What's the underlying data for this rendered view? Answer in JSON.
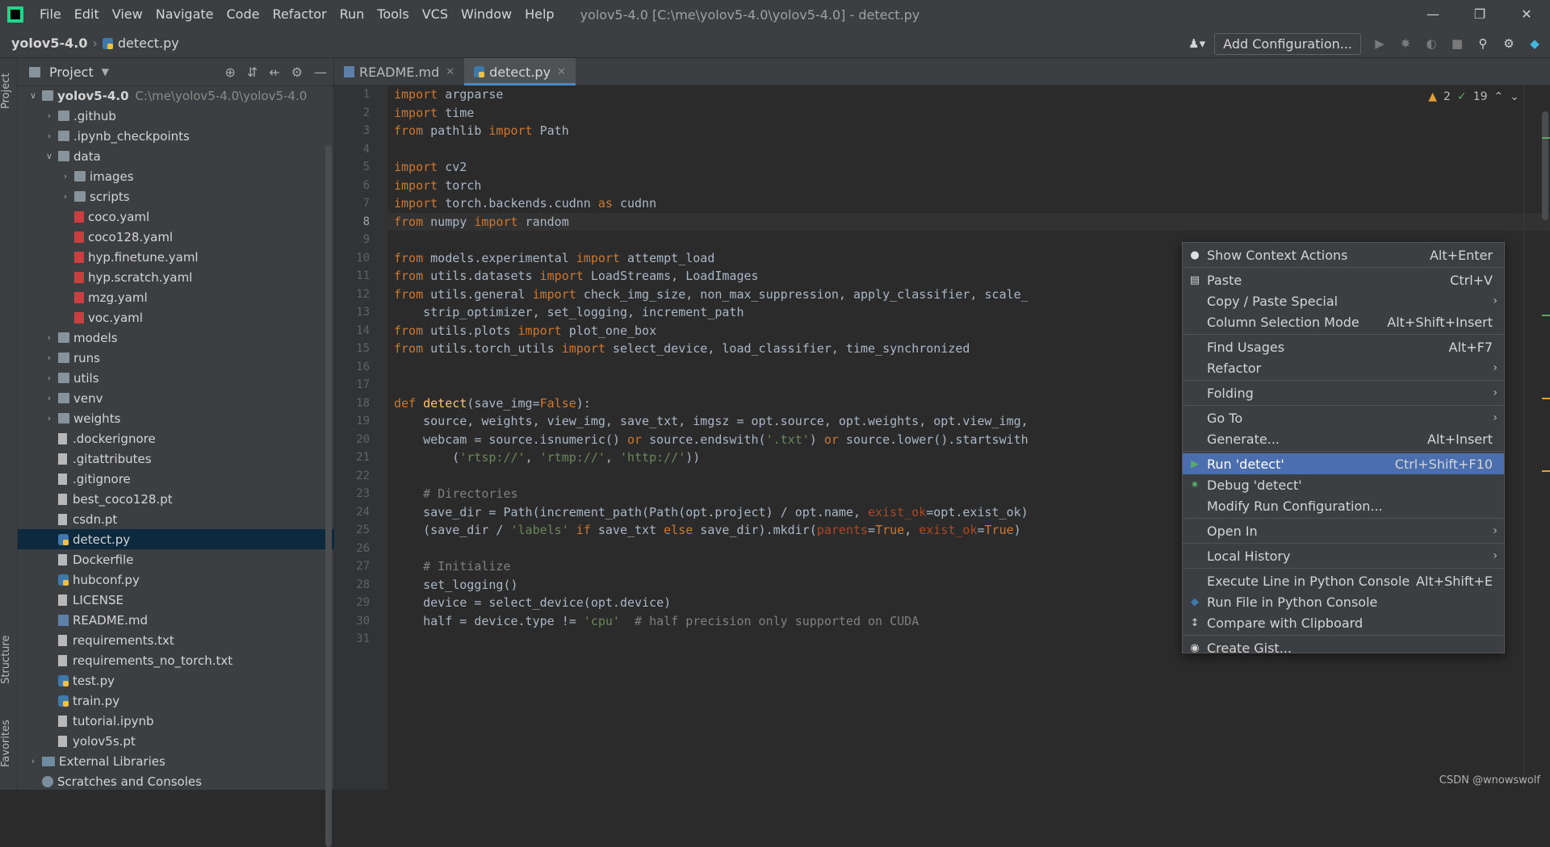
{
  "menubar": {
    "items": [
      "File",
      "Edit",
      "View",
      "Navigate",
      "Code",
      "Refactor",
      "Run",
      "Tools",
      "VCS",
      "Window",
      "Help"
    ],
    "window_title": "yolov5-4.0 [C:\\me\\yolov5-4.0\\yolov5-4.0] - detect.py"
  },
  "navbar": {
    "root": "yolov5-4.0",
    "file": "detect.py",
    "add_config": "Add Configuration..."
  },
  "side_tabs": {
    "project": "Project",
    "structure": "Structure",
    "favorites": "Favorites"
  },
  "project_panel": {
    "title": "Project",
    "tree": [
      {
        "label": "yolov5-4.0",
        "path": "C:\\me\\yolov5-4.0\\yolov5-4.0",
        "type": "folder",
        "depth": 0,
        "expanded": true,
        "bold": true
      },
      {
        "label": ".github",
        "type": "folder",
        "depth": 1,
        "expanded": false
      },
      {
        "label": ".ipynb_checkpoints",
        "type": "folder",
        "depth": 1,
        "expanded": false
      },
      {
        "label": "data",
        "type": "folder",
        "depth": 1,
        "expanded": true
      },
      {
        "label": "images",
        "type": "folder",
        "depth": 2,
        "expanded": false
      },
      {
        "label": "scripts",
        "type": "folder",
        "depth": 2,
        "expanded": false
      },
      {
        "label": "coco.yaml",
        "type": "yaml",
        "depth": 2
      },
      {
        "label": "coco128.yaml",
        "type": "yaml",
        "depth": 2
      },
      {
        "label": "hyp.finetune.yaml",
        "type": "yaml",
        "depth": 2
      },
      {
        "label": "hyp.scratch.yaml",
        "type": "yaml",
        "depth": 2
      },
      {
        "label": "mzg.yaml",
        "type": "yaml",
        "depth": 2
      },
      {
        "label": "voc.yaml",
        "type": "yaml",
        "depth": 2
      },
      {
        "label": "models",
        "type": "folder",
        "depth": 1,
        "expanded": false
      },
      {
        "label": "runs",
        "type": "folder",
        "depth": 1,
        "expanded": false
      },
      {
        "label": "utils",
        "type": "folder",
        "depth": 1,
        "expanded": false
      },
      {
        "label": "venv",
        "type": "folder",
        "depth": 1,
        "expanded": false
      },
      {
        "label": "weights",
        "type": "folder",
        "depth": 1,
        "expanded": false
      },
      {
        "label": ".dockerignore",
        "type": "file",
        "depth": 1
      },
      {
        "label": ".gitattributes",
        "type": "file",
        "depth": 1
      },
      {
        "label": ".gitignore",
        "type": "file",
        "depth": 1
      },
      {
        "label": "best_coco128.pt",
        "type": "file",
        "depth": 1
      },
      {
        "label": "csdn.pt",
        "type": "file",
        "depth": 1
      },
      {
        "label": "detect.py",
        "type": "py",
        "depth": 1,
        "selected": true
      },
      {
        "label": "Dockerfile",
        "type": "file",
        "depth": 1
      },
      {
        "label": "hubconf.py",
        "type": "py",
        "depth": 1
      },
      {
        "label": "LICENSE",
        "type": "file",
        "depth": 1
      },
      {
        "label": "README.md",
        "type": "md",
        "depth": 1
      },
      {
        "label": "requirements.txt",
        "type": "file",
        "depth": 1
      },
      {
        "label": "requirements_no_torch.txt",
        "type": "file",
        "depth": 1
      },
      {
        "label": "test.py",
        "type": "py",
        "depth": 1
      },
      {
        "label": "train.py",
        "type": "py",
        "depth": 1
      },
      {
        "label": "tutorial.ipynb",
        "type": "file",
        "depth": 1
      },
      {
        "label": "yolov5s.pt",
        "type": "file",
        "depth": 1
      },
      {
        "label": "External Libraries",
        "type": "lib",
        "depth": 0,
        "expanded": false
      },
      {
        "label": "Scratches and Consoles",
        "type": "scratch",
        "depth": 0
      }
    ]
  },
  "tabs": [
    {
      "label": "README.md",
      "icon": "md-icon",
      "active": false
    },
    {
      "label": "detect.py",
      "icon": "python-icon",
      "active": true
    }
  ],
  "editor": {
    "current_line": 8,
    "inspections": {
      "warnings": "2",
      "ok": "19"
    },
    "lines": [
      [
        [
          "kw",
          "import"
        ],
        [
          "",
          " argparse"
        ]
      ],
      [
        [
          "kw",
          "import"
        ],
        [
          "",
          " time"
        ]
      ],
      [
        [
          "kw",
          "from"
        ],
        [
          "",
          " pathlib "
        ],
        [
          "kw",
          "import"
        ],
        [
          "",
          " Path"
        ]
      ],
      [],
      [
        [
          "kw",
          "import"
        ],
        [
          "",
          " cv2"
        ]
      ],
      [
        [
          "kw",
          "import"
        ],
        [
          "",
          " torch"
        ]
      ],
      [
        [
          "kw",
          "import"
        ],
        [
          "",
          " torch.backends.cudnn "
        ],
        [
          "kw",
          "as"
        ],
        [
          "",
          " cudnn"
        ]
      ],
      [
        [
          "kw",
          "from"
        ],
        [
          "",
          " numpy "
        ],
        [
          "kw",
          "import"
        ],
        [
          "",
          " random"
        ]
      ],
      [],
      [
        [
          "kw",
          "from"
        ],
        [
          "",
          " models.experimental "
        ],
        [
          "kw",
          "import"
        ],
        [
          "",
          " attempt_load"
        ]
      ],
      [
        [
          "kw",
          "from"
        ],
        [
          "",
          " utils.datasets "
        ],
        [
          "kw",
          "import"
        ],
        [
          "",
          " LoadStreams, LoadImages"
        ]
      ],
      [
        [
          "kw",
          "from"
        ],
        [
          "",
          " utils.general "
        ],
        [
          "kw",
          "import"
        ],
        [
          "",
          " check_img_size, non_max_suppression, apply_classifier, scale_"
        ]
      ],
      [
        [
          "",
          "    strip_optimizer, set_logging, increment_path"
        ]
      ],
      [
        [
          "kw",
          "from"
        ],
        [
          "",
          " utils.plots "
        ],
        [
          "kw",
          "import"
        ],
        [
          "",
          " plot_one_box"
        ]
      ],
      [
        [
          "kw",
          "from"
        ],
        [
          "",
          " utils.torch_utils "
        ],
        [
          "kw",
          "import"
        ],
        [
          "",
          " select_device, load_classifier, time_synchronized"
        ]
      ],
      [],
      [],
      [
        [
          "kw",
          "def"
        ],
        [
          "",
          " "
        ],
        [
          "fn",
          "detect"
        ],
        [
          "",
          "(save_img="
        ],
        [
          "kw",
          "False"
        ],
        [
          "",
          "):"
        ]
      ],
      [
        [
          "",
          "    source, weights, view_img, save_txt, imgsz = opt.source, opt.weights, opt.view_img,"
        ]
      ],
      [
        [
          "",
          "    webcam = source.isnumeric() "
        ],
        [
          "kw",
          "or"
        ],
        [
          "",
          " source.endswith("
        ],
        [
          "str",
          "'.txt'"
        ],
        [
          "",
          ") "
        ],
        [
          "kw",
          "or"
        ],
        [
          "",
          " source.lower().startswith"
        ]
      ],
      [
        [
          "",
          "        ("
        ],
        [
          "str",
          "'rtsp://'"
        ],
        [
          "",
          ", "
        ],
        [
          "str",
          "'rtmp://'"
        ],
        [
          "",
          ", "
        ],
        [
          "str",
          "'http://'"
        ],
        [
          "",
          "))"
        ]
      ],
      [],
      [
        [
          "cm",
          "    # Directories"
        ]
      ],
      [
        [
          "",
          "    save_dir = Path(increment_path(Path(opt.project) / opt.name, "
        ],
        [
          "par",
          "exist_ok"
        ],
        [
          "",
          "=opt.exist_ok)"
        ]
      ],
      [
        [
          "",
          "    (save_dir / "
        ],
        [
          "str",
          "'labels'"
        ],
        [
          "",
          " "
        ],
        [
          "kw",
          "if"
        ],
        [
          "",
          " save_txt "
        ],
        [
          "kw",
          "else"
        ],
        [
          "",
          " save_dir).mkdir("
        ],
        [
          "par",
          "parents"
        ],
        [
          "",
          "="
        ],
        [
          "kw",
          "True"
        ],
        [
          "",
          ", "
        ],
        [
          "par",
          "exist_ok"
        ],
        [
          "",
          "="
        ],
        [
          "kw",
          "True"
        ],
        [
          "",
          ")"
        ]
      ],
      [],
      [
        [
          "cm",
          "    # Initialize"
        ]
      ],
      [
        [
          "",
          "    set_logging()"
        ]
      ],
      [
        [
          "",
          "    device = select_device(opt.device)"
        ]
      ],
      [
        [
          "",
          "    half = device.type != "
        ],
        [
          "str",
          "'cpu'"
        ],
        [
          "",
          "  "
        ],
        [
          "cm",
          "# half precision only supported on CUDA"
        ]
      ],
      []
    ]
  },
  "context_menu": {
    "items": [
      {
        "label": "Show Context Actions",
        "shortcut": "Alt+Enter",
        "icon": "bulb-icon"
      },
      {
        "sep": true
      },
      {
        "label": "Paste",
        "shortcut": "Ctrl+V",
        "icon": "clipboard-icon"
      },
      {
        "label": "Copy / Paste Special",
        "submenu": true
      },
      {
        "label": "Column Selection Mode",
        "shortcut": "Alt+Shift+Insert"
      },
      {
        "sep": true
      },
      {
        "label": "Find Usages",
        "shortcut": "Alt+F7"
      },
      {
        "label": "Refactor",
        "submenu": true
      },
      {
        "sep": true
      },
      {
        "label": "Folding",
        "submenu": true
      },
      {
        "sep": true
      },
      {
        "label": "Go To",
        "submenu": true
      },
      {
        "label": "Generate...",
        "shortcut": "Alt+Insert"
      },
      {
        "sep": true
      },
      {
        "label": "Run 'detect'",
        "shortcut": "Ctrl+Shift+F10",
        "icon": "run-icon",
        "highlighted": true
      },
      {
        "label": "Debug 'detect'",
        "icon": "debug-icon"
      },
      {
        "label": "Modify Run Configuration..."
      },
      {
        "sep": true
      },
      {
        "label": "Open In",
        "submenu": true
      },
      {
        "sep": true
      },
      {
        "label": "Local History",
        "submenu": true
      },
      {
        "sep": true
      },
      {
        "label": "Execute Line in Python Console",
        "shortcut": "Alt+Shift+E"
      },
      {
        "label": "Run File in Python Console",
        "icon": "python-icon"
      },
      {
        "label": "Compare with Clipboard",
        "icon": "compare-icon"
      },
      {
        "sep": true
      },
      {
        "label": "Create Gist...",
        "icon": "github-icon"
      }
    ]
  },
  "status": {
    "watermark": "CSDN @wnowswolf"
  },
  "colors": {
    "accent": "#4b6eaf",
    "selection": "#0d293e",
    "keyword": "#cc7832",
    "string": "#6a8759"
  }
}
